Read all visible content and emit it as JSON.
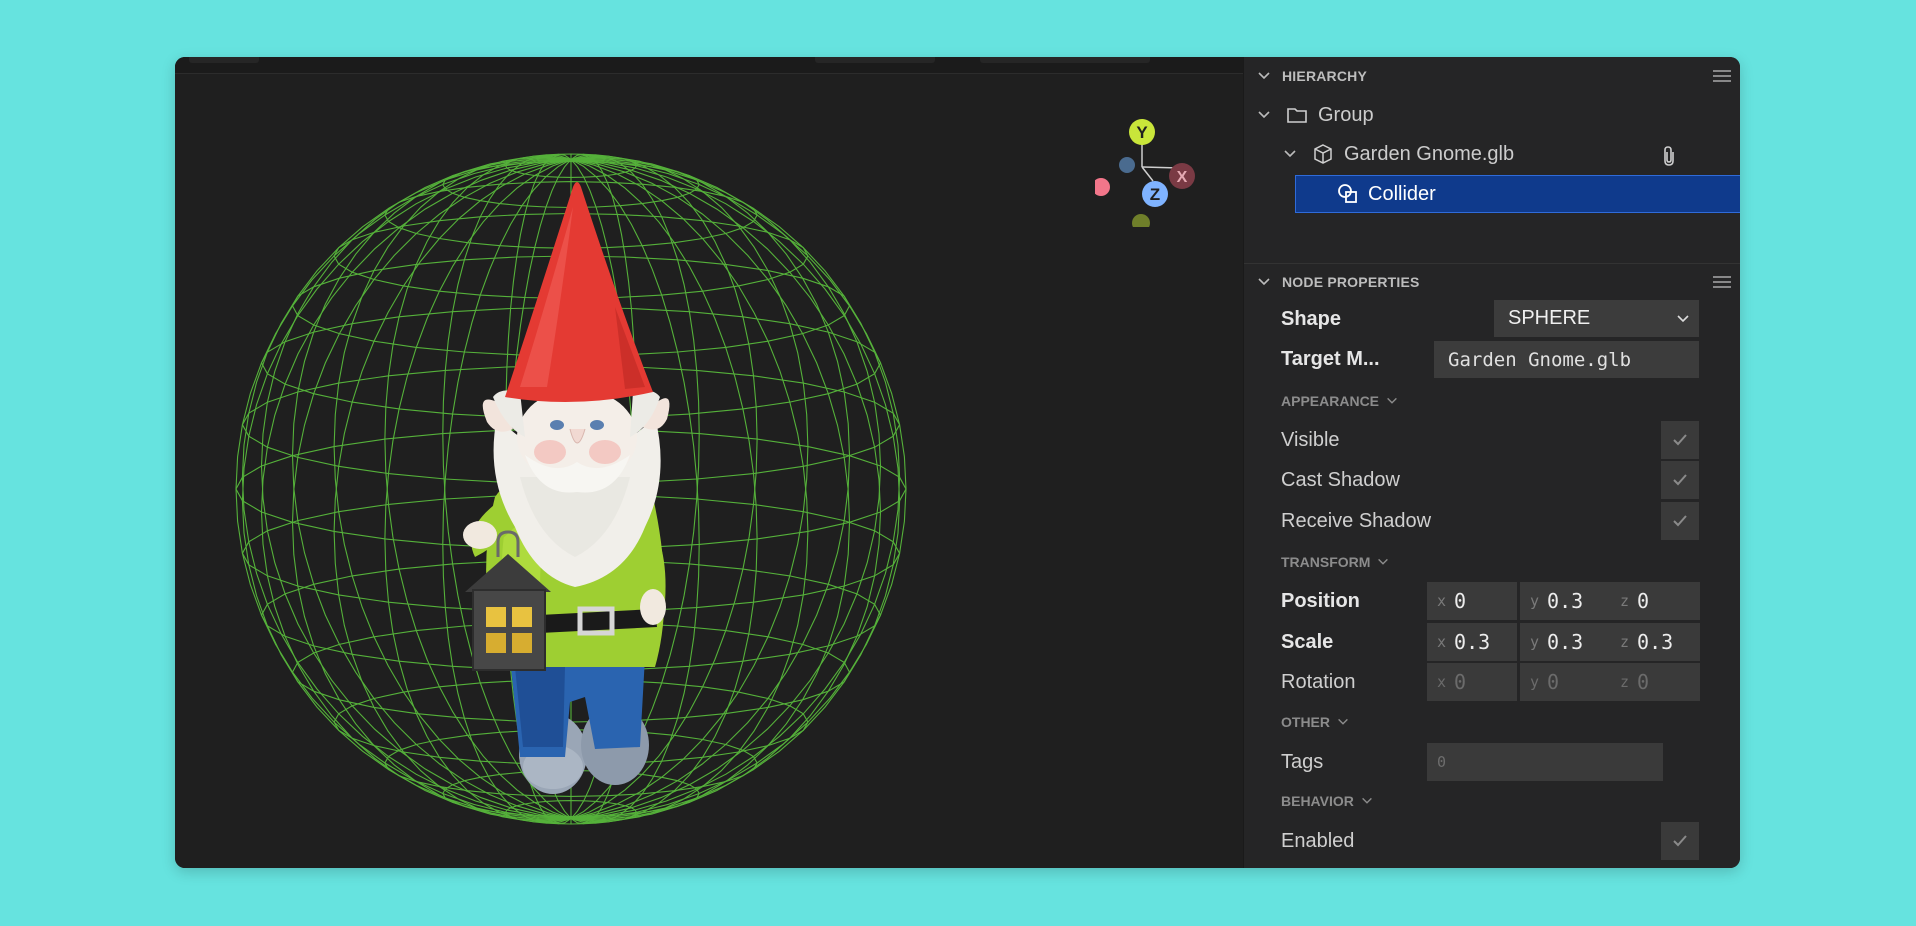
{
  "hierarchy": {
    "title": "HIERARCHY",
    "items": [
      {
        "label": "Group",
        "icon": "folder-icon"
      },
      {
        "label": "Garden Gnome.glb",
        "icon": "cube-icon"
      },
      {
        "label": "Collider",
        "icon": "shapes-icon",
        "selected": true
      }
    ]
  },
  "node_properties": {
    "title": "NODE PROPERTIES",
    "shape": {
      "label": "Shape",
      "value": "SPHERE"
    },
    "target_mesh": {
      "label": "Target M...",
      "value": "Garden Gnome.glb"
    },
    "appearance": {
      "label": "APPEARANCE",
      "visible": {
        "label": "Visible",
        "checked": true
      },
      "cast_shadow": {
        "label": "Cast Shadow",
        "checked": true
      },
      "receive_shadow": {
        "label": "Receive Shadow",
        "checked": true
      }
    },
    "transform": {
      "label": "TRANSFORM",
      "position": {
        "label": "Position",
        "x": "0",
        "y": "0.3",
        "z": "0"
      },
      "scale": {
        "label": "Scale",
        "x": "0.3",
        "y": "0.3",
        "z": "0.3"
      },
      "rotation": {
        "label": "Rotation",
        "x": "0",
        "y": "0",
        "z": "0"
      }
    },
    "other": {
      "label": "OTHER",
      "tags": {
        "label": "Tags",
        "placeholder": "0"
      }
    },
    "behavior": {
      "label": "BEHAVIOR",
      "enabled": {
        "label": "Enabled",
        "checked": true
      }
    }
  },
  "axis_labels": {
    "x": "x",
    "y": "y",
    "z": "z"
  },
  "gizmo": {
    "y": "Y",
    "x": "X",
    "z": "Z"
  },
  "colors": {
    "background": "#66e3df",
    "selection": "#0f3a8c",
    "wireframe": "#58b93c",
    "gizmo_y": "#c9e63a",
    "gizmo_x": "#7a3a44",
    "gizmo_z": "#7fb3ff"
  }
}
